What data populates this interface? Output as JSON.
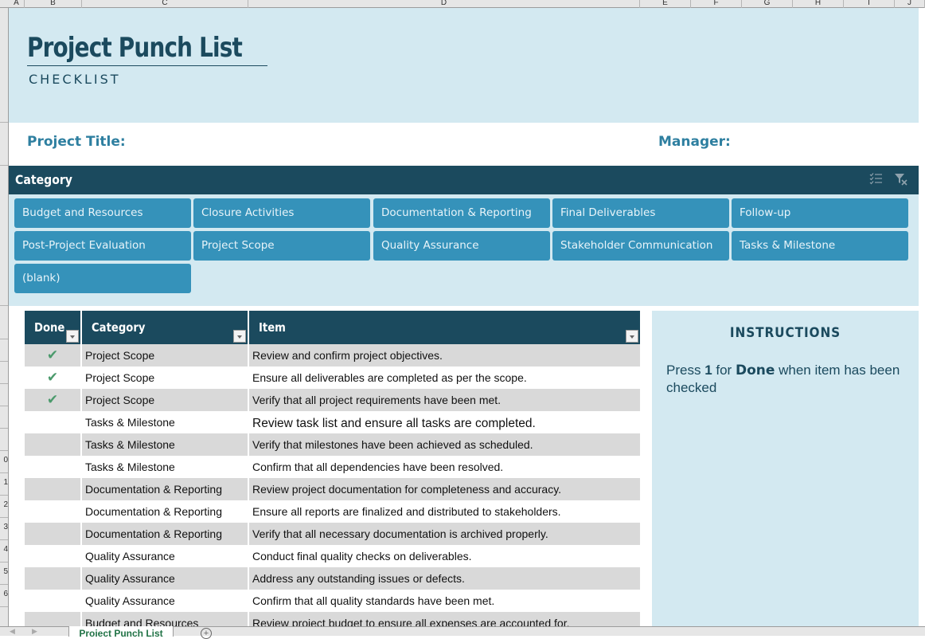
{
  "spreadsheet": {
    "columns": [
      "A",
      "B",
      "C",
      "D",
      "E",
      "F",
      "G",
      "H",
      "I",
      "J"
    ],
    "row_numbers_visible": [
      "",
      "",
      "",
      "",
      "",
      "",
      "",
      "",
      "0",
      "1",
      "2",
      "3",
      "4",
      "5",
      "6"
    ]
  },
  "header": {
    "title": "Project Punch List",
    "subtitle": "CHECKLIST"
  },
  "info": {
    "project_title_label": "Project Title:",
    "project_title_value": "",
    "manager_label": "Manager:",
    "manager_value": ""
  },
  "slicer": {
    "title": "Category",
    "icons": [
      "multi-select-icon",
      "clear-filter-icon"
    ],
    "items": [
      {
        "label": "Budget and Resources"
      },
      {
        "label": "Closure Activities"
      },
      {
        "label": "Documentation & Reporting"
      },
      {
        "label": "Final Deliverables"
      },
      {
        "label": "Follow-up"
      },
      {
        "label": "Post-Project Evaluation"
      },
      {
        "label": "Project Scope"
      },
      {
        "label": "Quality Assurance"
      },
      {
        "label": "Stakeholder Communication"
      },
      {
        "label": "Tasks & Milestone"
      },
      {
        "label": "(blank)"
      }
    ]
  },
  "table": {
    "headers": {
      "done": "Done",
      "category": "Category",
      "item": "Item"
    },
    "check_glyph": "✔",
    "rows": [
      {
        "done": true,
        "category": "Project Scope",
        "item": "Review and confirm project objectives."
      },
      {
        "done": true,
        "category": "Project Scope",
        "item": "Ensure all deliverables are completed as per the scope."
      },
      {
        "done": true,
        "category": "Project Scope",
        "item": "Verify that all project requirements have been met."
      },
      {
        "done": false,
        "category": "Tasks & Milestone",
        "item": "Review task list and ensure all tasks are completed."
      },
      {
        "done": false,
        "category": "Tasks & Milestone",
        "item": "Verify that milestones have been achieved as scheduled."
      },
      {
        "done": false,
        "category": "Tasks & Milestone",
        "item": "Confirm that all dependencies have been resolved."
      },
      {
        "done": false,
        "category": "Documentation & Reporting",
        "item": "Review project documentation for completeness and accuracy."
      },
      {
        "done": false,
        "category": "Documentation & Reporting",
        "item": "Ensure all reports are finalized and distributed to stakeholders."
      },
      {
        "done": false,
        "category": "Documentation & Reporting",
        "item": "Verify that all necessary documentation is archived properly."
      },
      {
        "done": false,
        "category": "Quality Assurance",
        "item": "Conduct final quality checks on deliverables."
      },
      {
        "done": false,
        "category": "Quality Assurance",
        "item": "Address any outstanding issues or defects."
      },
      {
        "done": false,
        "category": "Quality Assurance",
        "item": "Confirm that all quality standards have been met."
      },
      {
        "done": false,
        "category": "Budget and Resources",
        "item": "Review project budget to ensure all expenses are accounted for."
      }
    ]
  },
  "instructions": {
    "title": "INSTRUCTIONS",
    "text_before": "Press ",
    "key": "1",
    "text_mid": " for ",
    "done_word": "Done",
    "text_after": " when item has been checked"
  },
  "sheet_tabs": {
    "active": "Project Punch List",
    "add_label": "+"
  },
  "colors": {
    "dark_teal": "#1b4a5e",
    "light_blue_bg": "#d3e9f1",
    "chip_blue": "#3592ba",
    "label_blue": "#2e7fa0",
    "check_green": "#4b9a6c",
    "row_shade": "#d9d9d9"
  }
}
